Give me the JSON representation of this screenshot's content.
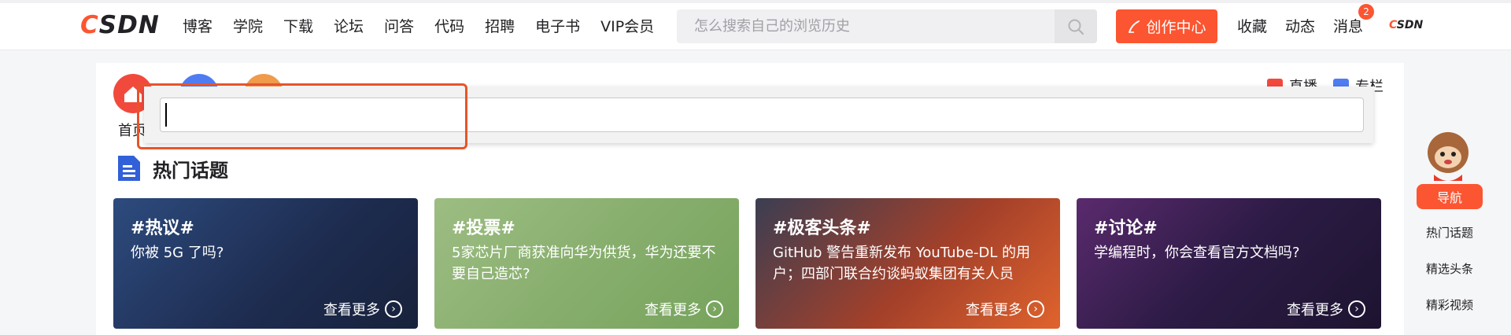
{
  "header": {
    "logo_c": "C",
    "logo_rest": "SDN",
    "nav": [
      "博客",
      "学院",
      "下载",
      "论坛",
      "问答",
      "代码",
      "招聘",
      "电子书",
      "VIP会员"
    ],
    "search_placeholder": "怎么搜索自己的浏览历史",
    "create_label": "创作中心",
    "right_nav": [
      "收藏",
      "动态",
      "消息"
    ],
    "message_count": "2",
    "mini_logo_c": "C",
    "mini_logo_rest": "SDN"
  },
  "quicknav": {
    "home_label": "首页",
    "right_links": [
      "直播",
      "专栏"
    ]
  },
  "search_overlay": {
    "value": ""
  },
  "hot_topics": {
    "title": "热门话题",
    "cards": [
      {
        "tag": "#热议#",
        "desc": "你被 5G 了吗?",
        "more": "查看更多",
        "color": "#1f2f52"
      },
      {
        "tag": "#投票#",
        "desc": "5家芯片厂商获准向华为供货，华为还要不要自己造芯?",
        "more": "查看更多",
        "color": "#86ad6c"
      },
      {
        "tag": "#极客头条#",
        "desc": "GitHub 警告重新发布 YouTube-DL 的用户；四部门联合约谈蚂蚁集团有关人员",
        "more": "查看更多",
        "color": "#b8452a"
      },
      {
        "tag": "#讨论#",
        "desc": "学编程时，你会查看官方文档吗?",
        "more": "查看更多",
        "color": "#3a1b4e"
      }
    ]
  },
  "sidebar": {
    "guide_label": "导航",
    "links": [
      "热门话题",
      "精选头条",
      "精彩视频"
    ]
  }
}
